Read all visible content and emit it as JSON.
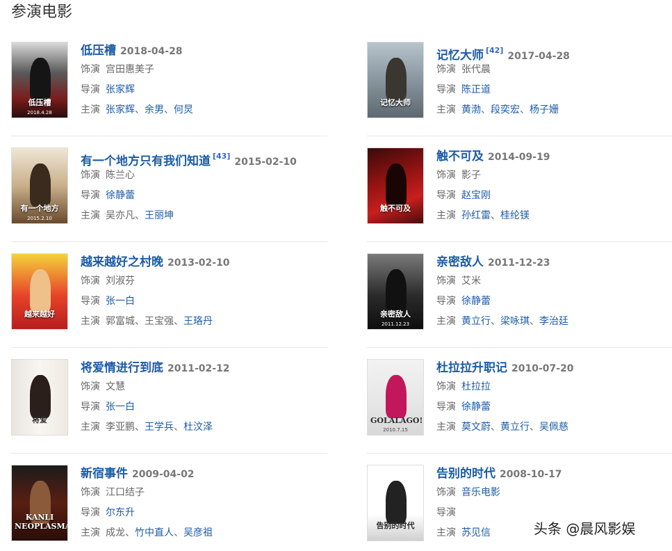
{
  "section_title": "参演电影",
  "labels": {
    "role": "饰演",
    "director": "导演",
    "cast": "主演"
  },
  "watermark": "头条 @晨风影娱",
  "films": [
    {
      "title": "低压槽",
      "date": "2018-04-28",
      "role": [
        "宫田惠美子"
      ],
      "role_link": false,
      "director": [
        "张家辉"
      ],
      "cast": [
        {
          "name": "张家辉",
          "link": true
        },
        {
          "name": "余男",
          "link": true
        },
        {
          "name": "何炅",
          "link": true
        }
      ],
      "poster": {
        "bg": "linear-gradient(180deg,#d8d8d8 0%,#5a5a5a 40%,#7a1c1c 75%,#2a0d0d 100%)",
        "text": "低压槽",
        "text_dark": false,
        "date": "2018.4.28",
        "fig": "#151515"
      }
    },
    {
      "title": "记忆大师",
      "cite": "[42]",
      "date": "2017-04-28",
      "role": [
        "张代晨"
      ],
      "role_link": false,
      "director": [
        "陈正道"
      ],
      "cast": [
        {
          "name": "黄渤",
          "link": true
        },
        {
          "name": "段奕宏",
          "link": true
        },
        {
          "name": "杨子姗",
          "link": true
        }
      ],
      "poster": {
        "bg": "linear-gradient(180deg,#b8c4cc 0%,#8e9aa3 45%,#5d6870 100%)",
        "text": "记忆大师",
        "text_dark": false,
        "date": "",
        "fig": "#3a3630"
      }
    },
    {
      "title": "有一个地方只有我们知道",
      "cite": "[43]",
      "date": "2015-02-10",
      "role": [
        "陈兰心"
      ],
      "role_link": false,
      "director": [
        "徐静蕾"
      ],
      "cast": [
        {
          "name": "吴亦凡",
          "link": false
        },
        {
          "name": "王丽坤",
          "link": true
        }
      ],
      "poster": {
        "bg": "linear-gradient(180deg,#efe6d6 0%,#c9b08a 50%,#6a4a2c 100%)",
        "text": "有一个地方",
        "text_dark": false,
        "date": "2015.2.10",
        "fig": "#3b2a1e"
      }
    },
    {
      "title": "触不可及",
      "date": "2014-09-19",
      "role": [
        "影子"
      ],
      "role_link": false,
      "director": [
        "赵宝刚"
      ],
      "cast": [
        {
          "name": "孙红雷",
          "link": true
        },
        {
          "name": "桂纶镁",
          "link": true
        }
      ],
      "poster": {
        "bg": "linear-gradient(160deg,#3a0a0a 0%,#9b1414 45%,#c81e1e 70%,#4a0b0b 100%)",
        "text": "触不可及",
        "text_dark": false,
        "date": "",
        "fig": "#1a0505"
      }
    },
    {
      "title": "越来越好之村晚",
      "date": "2013-02-10",
      "role": [
        "刘淑芬"
      ],
      "role_link": false,
      "director": [
        "张一白"
      ],
      "cast": [
        {
          "name": "郭富城",
          "link": false
        },
        {
          "name": "王宝强",
          "link": false
        },
        {
          "name": "王珞丹",
          "link": true
        }
      ],
      "poster": {
        "bg": "linear-gradient(180deg,#f4d23a 0%,#e7442a 55%,#b71d1d 100%)",
        "text": "越来越好",
        "text_dark": false,
        "date": "",
        "fig": "#f0c08a"
      }
    },
    {
      "title": "亲密敌人",
      "date": "2011-12-23",
      "role": [
        "艾米"
      ],
      "role_link": false,
      "director": [
        "徐静蕾"
      ],
      "cast": [
        {
          "name": "黄立行",
          "link": true
        },
        {
          "name": "梁咏琪",
          "link": true
        },
        {
          "name": "李治廷",
          "link": true
        }
      ],
      "poster": {
        "bg": "linear-gradient(180deg,#7a7a7a 0%,#2b2b2b 55%,#0e0e0e 100%)",
        "text": "亲密敌人",
        "text_dark": false,
        "date": "2011.12.23",
        "fig": "#111111"
      }
    },
    {
      "title": "将爱情进行到底",
      "date": "2011-02-12",
      "role": [
        "文慧"
      ],
      "role_link": false,
      "director": [
        "张一白"
      ],
      "cast": [
        {
          "name": "李亚鹏",
          "link": false
        },
        {
          "name": "王学兵",
          "link": true
        },
        {
          "name": "杜汶泽",
          "link": true
        }
      ],
      "poster": {
        "bg": "linear-gradient(90deg,#e9e4de 0%,#f8f6f2 50%,#efe9e2 100%)",
        "text": "将爱",
        "text_dark": true,
        "date": "",
        "fig": "#2a1f1a"
      }
    },
    {
      "title": "杜拉拉升职记",
      "date": "2010-07-20",
      "role": [
        "杜拉拉"
      ],
      "role_link": true,
      "director": [
        "徐静蕾"
      ],
      "cast": [
        {
          "name": "莫文蔚",
          "link": true
        },
        {
          "name": "黄立行",
          "link": true
        },
        {
          "name": "吴佩慈",
          "link": true
        }
      ],
      "poster": {
        "bg": "linear-gradient(180deg,#f2f2f2 0%,#e6e6e6 60%,#d8d8d8 100%)",
        "text": "GOLALAGO!",
        "text_dark": true,
        "date": "2010.7.15",
        "fig": "#c2185b"
      }
    },
    {
      "title": "新宿事件",
      "date": "2009-04-02",
      "role": [
        "江口结子"
      ],
      "role_link": false,
      "director": [
        "尔东升"
      ],
      "cast": [
        {
          "name": "成龙",
          "link": false
        },
        {
          "name": "竹中直人",
          "link": true
        },
        {
          "name": "吴彦祖",
          "link": true
        }
      ],
      "poster": {
        "bg": "linear-gradient(180deg,#1c1c1c 0%,#5a1e12 50%,#2a0e08 100%)",
        "text": "KANLI NEOPLASMA",
        "text_dark": false,
        "date": "",
        "fig": "#8a5a3a"
      }
    },
    {
      "title": "告别的时代",
      "date": "2008-10-17",
      "role": [
        "音乐电影"
      ],
      "role_link": true,
      "director": [],
      "cast": [
        {
          "name": "苏见信",
          "link": true
        }
      ],
      "poster": {
        "bg": "linear-gradient(180deg,#ffffff 0%,#ffffff 65%,#d0d0d0 100%)",
        "text": "告别的时代",
        "text_dark": true,
        "date": "",
        "fig": "#222222"
      }
    }
  ]
}
